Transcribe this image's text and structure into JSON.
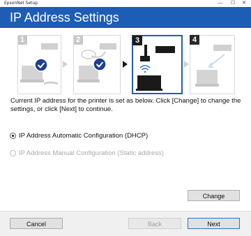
{
  "window": {
    "title": "EpsonNet Setup",
    "minimize_glyph": "—",
    "maximize_glyph": "☐",
    "close_glyph": "✕"
  },
  "header": {
    "title": "IP Address Settings",
    "bg_color": "#1e5db6"
  },
  "steps": [
    {
      "number": "1",
      "state": "done"
    },
    {
      "number": "2",
      "state": "done"
    },
    {
      "number": "3",
      "state": "current"
    },
    {
      "number": "4",
      "state": "pending"
    }
  ],
  "printer_label": "EPSON",
  "description": "Current IP address for the printer is set as below. Click [Change] to change the settings, or click [Next] to continue.",
  "options": [
    {
      "label": "IP Address Automatic Configuration (DHCP)",
      "selected": true,
      "enabled": true
    },
    {
      "label": "IP Address Manual Configuration (Static address)",
      "selected": false,
      "enabled": false
    }
  ],
  "buttons": {
    "change": "Change",
    "cancel": "Cancel",
    "back": "Back",
    "next": "Next"
  },
  "colors": {
    "accent": "#1e5db6",
    "check_circle": "#1c3f94",
    "step_active": "#1a1a1a",
    "step_inactive": "#c8c8c8"
  }
}
